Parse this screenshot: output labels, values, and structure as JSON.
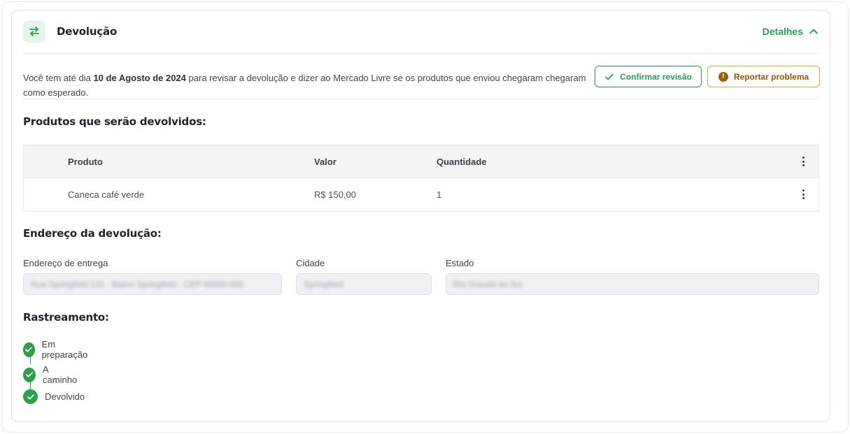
{
  "header": {
    "title": "Devolução",
    "details_label": "Detalhes"
  },
  "notice": {
    "text_before": "Você tem até dia ",
    "deadline": "10 de Agosto de 2024",
    "text_after": " para revisar a devolução e dizer ao Mercado Livre se os produtos que enviou chegaram chegaram como esperado."
  },
  "actions": {
    "confirm_label": "Confirmar revisão",
    "report_label": "Reportar problema"
  },
  "products": {
    "title": "Produtos que serão devolvidos:",
    "columns": {
      "product": "Produto",
      "value": "Valor",
      "quantity": "Quantidade"
    },
    "rows": [
      {
        "product": "Caneca café verde",
        "value": "R$ 150,00",
        "quantity": "1"
      }
    ]
  },
  "address": {
    "title": "Endereço da devolução:",
    "fields": [
      {
        "label": "Endereço de entrega",
        "value": "Rua Springfield 131 - Bairro Springfield - CEP 00000-000"
      },
      {
        "label": "Cidade",
        "value": "Springfield"
      },
      {
        "label": "Estado",
        "value": "Rio Grande do Sul"
      }
    ]
  },
  "tracking": {
    "title": "Rastreamento:",
    "steps": [
      {
        "label": "Em preparação"
      },
      {
        "label": "A caminho"
      },
      {
        "label": "Devolvido"
      }
    ]
  },
  "colors": {
    "accent": "#2a9d52",
    "warning": "#e0a82e",
    "step": "#27a14a"
  },
  "icons": {
    "header": "swap-arrows-icon",
    "details": "chevron-up-icon",
    "confirm": "check-icon",
    "report": "warning-icon",
    "row_menu": "kebab-menu-icon",
    "step": "check-circle-icon"
  }
}
